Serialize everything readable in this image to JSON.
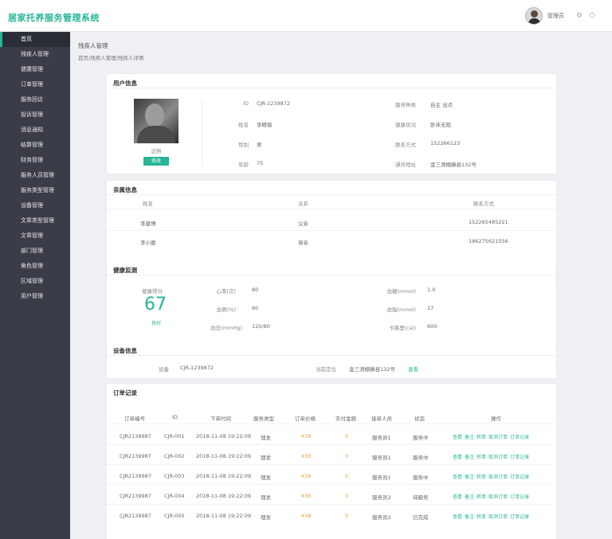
{
  "app": {
    "title": "居家托养服务管理系统"
  },
  "header": {
    "user_name": "管理员"
  },
  "sidebar": {
    "items": [
      {
        "label": "首页",
        "active": true
      },
      {
        "label": "残疾人管理"
      },
      {
        "label": "健康管理"
      },
      {
        "label": "订单管理"
      },
      {
        "label": "服务回访"
      },
      {
        "label": "投诉管理"
      },
      {
        "label": "消息通知"
      },
      {
        "label": "结算管理"
      },
      {
        "label": "财务管理"
      },
      {
        "label": "服务人员管理"
      },
      {
        "label": "服务类型管理"
      },
      {
        "label": "设备管理"
      },
      {
        "label": "文章类型管理"
      },
      {
        "label": "文章管理"
      },
      {
        "label": "部门管理"
      },
      {
        "label": "角色管理"
      },
      {
        "label": "区域管理"
      },
      {
        "label": "用户管理"
      }
    ]
  },
  "page": {
    "title": "残疾人管理",
    "breadcrumb": "首页/残疾人管理/残疾人详情"
  },
  "user_info": {
    "title": "用户信息",
    "photo_caption": "近照",
    "edit_label": "修改",
    "fields_left": [
      {
        "label": "ID",
        "value": "CJR-1239872"
      },
      {
        "label": "姓名",
        "value": "李精菊"
      },
      {
        "label": "性别",
        "value": "男"
      },
      {
        "label": "年龄",
        "value": "75"
      }
    ],
    "fields_right": [
      {
        "label": "服务种类",
        "value": "自主  出点"
      },
      {
        "label": "健康状况",
        "value": "卧床无阻"
      },
      {
        "label": "联系方式",
        "value": "152266123"
      },
      {
        "label": "通讯地址",
        "value": "金三清棚藤县132号"
      }
    ]
  },
  "family": {
    "title": "亲属信息",
    "headers": [
      "姓名",
      "关系",
      "联系方式"
    ],
    "rows": [
      [
        "李建博",
        "父亲",
        "15226548522​1"
      ],
      [
        "李小磨",
        "母亲",
        "18627562​1556"
      ]
    ]
  },
  "health": {
    "title": "健康监测",
    "score_label": "健康得分",
    "score": "67",
    "status": "良好",
    "left": [
      {
        "label": "心率(次)",
        "value": "80"
      },
      {
        "label": "血氧(%)",
        "value": "60"
      },
      {
        "label": "血压(mmHg)",
        "value": "120/80"
      }
    ],
    "right": [
      {
        "label": "血糖(mmol)",
        "value": "1.0"
      },
      {
        "label": "血脂(mmol)",
        "value": "17"
      },
      {
        "label": "卡路里(cal)",
        "value": "600"
      }
    ]
  },
  "device": {
    "title": "设备信息",
    "device_label": "设备",
    "device_value": "CJR-1239872",
    "location_label": "当前定位",
    "location_value": "金三清棚藤县132号",
    "view_label": "查看"
  },
  "orders": {
    "title": "订单记录",
    "headers": [
      "订单编号",
      "ID",
      "下单时间",
      "服务类型",
      "订单价格",
      "实付金额",
      "接单人员",
      "状态",
      "操作"
    ],
    "actions": [
      "查看",
      "备注",
      "转单",
      "取消订单",
      "订单记录"
    ],
    "rows": [
      [
        "CJR2139987",
        "CJR-001",
        "2018-11-08 19:22:09",
        "理发",
        "¥38",
        "0",
        "服务员1",
        "服务中"
      ],
      [
        "CJR2139987",
        "CJR-002",
        "2018-11-08 19:22:09",
        "理发",
        "¥38",
        "0",
        "服务员1",
        "服务中"
      ],
      [
        "CJR2139987",
        "CJR-003",
        "2018-11-08 19:22:09",
        "理发",
        "¥38",
        "0",
        "服务员1",
        "服务中"
      ],
      [
        "CJR2139987",
        "CJR-004",
        "2018-11-08 19:22:09",
        "理发",
        "¥38",
        "0",
        "服务员2",
        "待服务"
      ],
      [
        "CJR2139987",
        "CJR-005",
        "2018-11-08 19:22:09",
        "理发",
        "¥38",
        "0",
        "服务员2",
        "已完成"
      ]
    ]
  },
  "colors": {
    "accent": "#26b596",
    "sidebar": "#3a3d48",
    "amount": "#e3a13d"
  }
}
